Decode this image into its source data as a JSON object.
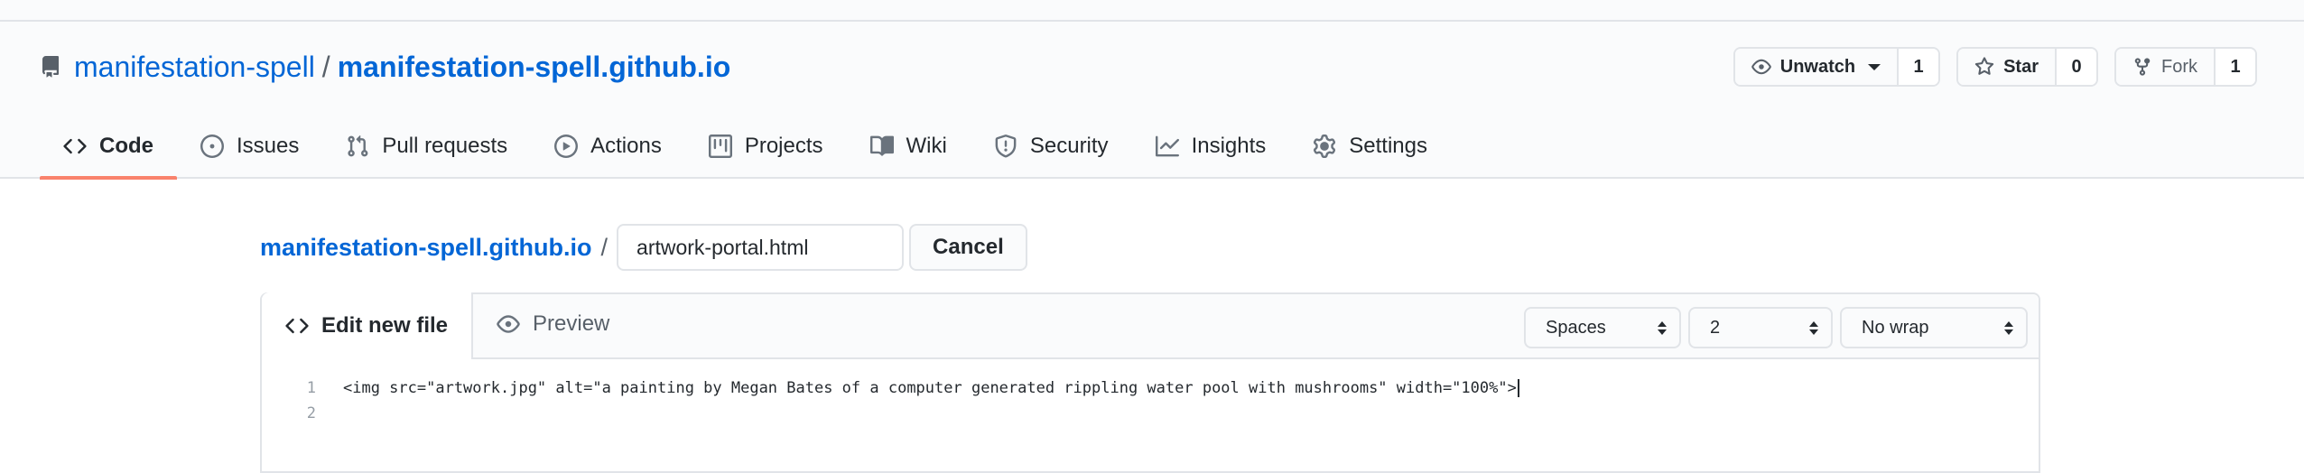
{
  "repo": {
    "owner": "manifestation-spell",
    "separator": "/",
    "name": "manifestation-spell.github.io"
  },
  "header_actions": {
    "watch_label": "Unwatch",
    "watch_count": "1",
    "star_label": "Star",
    "star_count": "0",
    "fork_label": "Fork",
    "fork_count": "1"
  },
  "tabs": [
    {
      "label": "Code",
      "icon": "code-icon",
      "selected": true
    },
    {
      "label": "Issues",
      "icon": "issue-icon"
    },
    {
      "label": "Pull requests",
      "icon": "pull-request-icon"
    },
    {
      "label": "Actions",
      "icon": "play-icon"
    },
    {
      "label": "Projects",
      "icon": "project-icon"
    },
    {
      "label": "Wiki",
      "icon": "book-icon"
    },
    {
      "label": "Security",
      "icon": "shield-icon"
    },
    {
      "label": "Insights",
      "icon": "graph-icon"
    },
    {
      "label": "Settings",
      "icon": "gear-icon"
    }
  ],
  "path": {
    "repo_link": "manifestation-spell.github.io",
    "separator": "/",
    "filename_value": "artwork-portal.html",
    "cancel_label": "Cancel"
  },
  "editor": {
    "edit_tab_label": "Edit new file",
    "preview_tab_label": "Preview",
    "indent_mode": "Spaces",
    "indent_size": "2",
    "wrap_mode": "No wrap",
    "lines": [
      {
        "number": "1",
        "text": "<img src=\"artwork.jpg\" alt=\"a painting by Megan Bates of a computer generated rippling water pool with mushrooms\" width=\"100%\">"
      },
      {
        "number": "2",
        "text": ""
      }
    ]
  },
  "colors": {
    "link": "#0366d6",
    "tab_underline": "#f9826c",
    "border": "#e1e4e8",
    "header_bg": "#fafbfc"
  }
}
